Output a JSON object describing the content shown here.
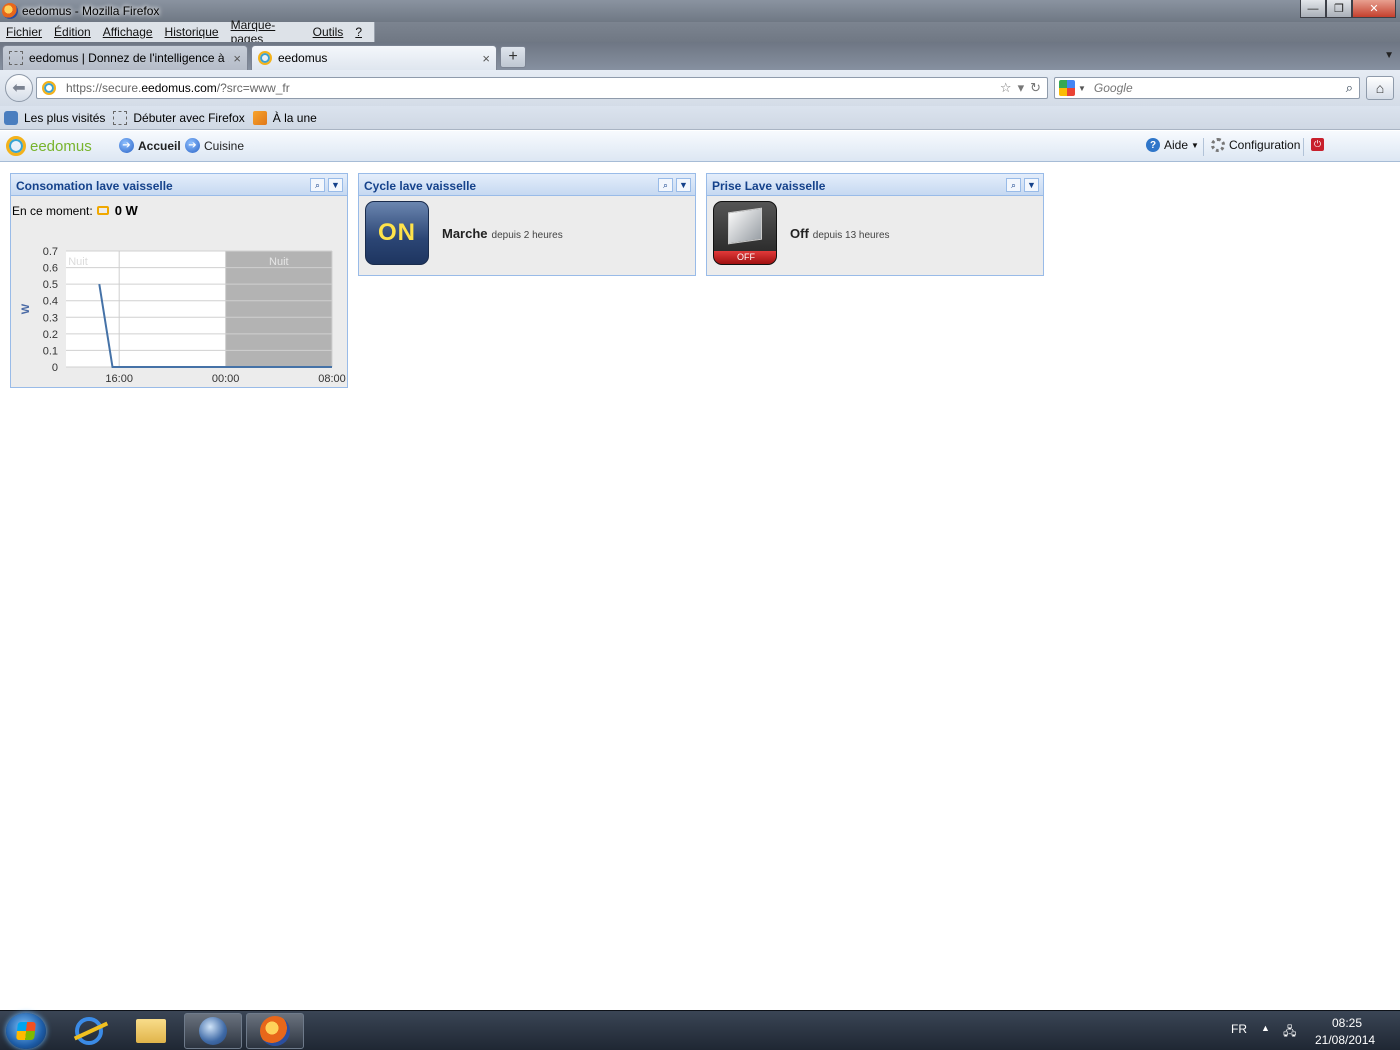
{
  "window": {
    "title": "eedomus - Mozilla Firefox"
  },
  "menu": [
    "Fichier",
    "Édition",
    "Affichage",
    "Historique",
    "Marque-pages",
    "Outils",
    "?"
  ],
  "tabs": [
    {
      "label": "eedomus | Donnez de l'intelligence à ...",
      "close": "×"
    },
    {
      "label": "eedomus",
      "close": "×"
    }
  ],
  "new_tab": "+",
  "url": {
    "prefix": "https://secure.",
    "domain": "eedomus.com",
    "suffix": "/?src=www_fr"
  },
  "search": {
    "placeholder": "Google"
  },
  "bookmarks": [
    "Les plus visités",
    "Débuter avec Firefox",
    "À la une"
  ],
  "app": {
    "logo": "eedomus",
    "nav": [
      "Accueil",
      "Cuisine"
    ],
    "help": "Aide",
    "config": "Configuration"
  },
  "widgets": {
    "conso": {
      "title": "Consomation lave vaisselle",
      "moment_label": "En ce moment:",
      "moment_value": "0 W"
    },
    "cycle": {
      "title": "Cycle lave vaisselle",
      "tile": "ON",
      "state": "Marche",
      "since": "depuis 2 heures"
    },
    "prise": {
      "title": "Prise Lave vaisselle",
      "tile": "OFF",
      "state": "Off",
      "since": "depuis 13 heures"
    }
  },
  "chart_data": {
    "type": "line",
    "ylabel": "W",
    "ylim": [
      0,
      0.7
    ],
    "yticks": [
      "0.7",
      "0.6",
      "0.5",
      "0.4",
      "0.3",
      "0.2",
      "0.1",
      "0"
    ],
    "xticks": [
      "16:00",
      "00:00",
      "08:00"
    ],
    "bands": [
      {
        "label": "Nuit",
        "from": "00:00",
        "to": "08:00"
      },
      {
        "label": "Nuit",
        "before": "16:00"
      }
    ],
    "series": [
      {
        "x": [
          "14:30",
          "15:30",
          "23:59",
          "08:00"
        ],
        "values": [
          0.5,
          0,
          0,
          0
        ]
      }
    ]
  },
  "taskbar": {
    "lang": "FR",
    "time": "08:25",
    "date": "21/08/2014"
  }
}
